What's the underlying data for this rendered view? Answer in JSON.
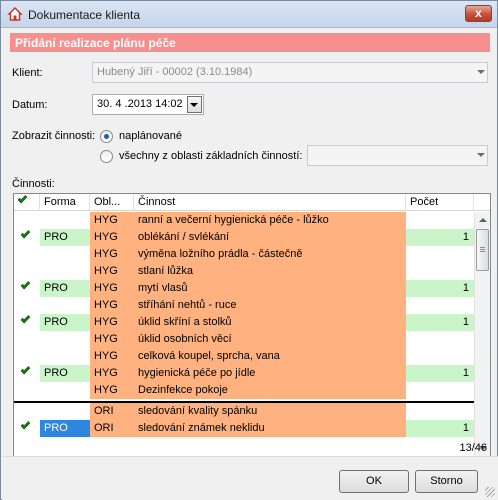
{
  "window": {
    "title": "Dokumentace klienta",
    "close_label": "x"
  },
  "banner": {
    "text": "Přidání realizace plánu péče"
  },
  "client": {
    "label": "Klient:",
    "value": "Hubený Jiří - 00002 (3.10.1984)"
  },
  "date": {
    "label": "Datum:",
    "value": "30. 4 .2013 14:02"
  },
  "show": {
    "label": "Zobrazit činnosti:",
    "options": [
      {
        "label": "naplánované",
        "selected": true
      },
      {
        "label": "všechny z oblasti základních činností:",
        "selected": false
      }
    ],
    "area_value": ""
  },
  "activities": {
    "label": "Činnosti:",
    "columns": [
      "",
      "Forma",
      "Obl...",
      "Činnost",
      "Počet"
    ],
    "rows": [
      {
        "checked": false,
        "forma": "",
        "obl": "HYG",
        "cinnost": "ranní a večerní hygienická péče - lůžko",
        "pocet": ""
      },
      {
        "checked": true,
        "forma": "PRO",
        "obl": "HYG",
        "cinnost": "oblékání / svlékání",
        "pocet": "1"
      },
      {
        "checked": false,
        "forma": "",
        "obl": "HYG",
        "cinnost": "výměna ložního prádla - částečně",
        "pocet": ""
      },
      {
        "checked": false,
        "forma": "",
        "obl": "HYG",
        "cinnost": "stlaní lůžka",
        "pocet": ""
      },
      {
        "checked": true,
        "forma": "PRO",
        "obl": "HYG",
        "cinnost": "mytí vlasů",
        "pocet": "1"
      },
      {
        "checked": false,
        "forma": "",
        "obl": "HYG",
        "cinnost": "stříhání nehtů - ruce",
        "pocet": ""
      },
      {
        "checked": true,
        "forma": "PRO",
        "obl": "HYG",
        "cinnost": "úklid skříní a stolků",
        "pocet": "1"
      },
      {
        "checked": false,
        "forma": "",
        "obl": "HYG",
        "cinnost": "úklid osobních věcí",
        "pocet": ""
      },
      {
        "checked": false,
        "forma": "",
        "obl": "HYG",
        "cinnost": "celková koupel, sprcha, vana",
        "pocet": ""
      },
      {
        "checked": true,
        "forma": "PRO",
        "obl": "HYG",
        "cinnost": "hygienická péče po jídle",
        "pocet": "1"
      },
      {
        "checked": false,
        "forma": "",
        "obl": "HYG",
        "cinnost": "Dezinfekce pokoje",
        "pocet": ""
      },
      {
        "checked": false,
        "forma": "",
        "obl": "ORI",
        "cinnost": "sledování kvality spánku",
        "pocet": ""
      },
      {
        "checked": true,
        "forma": "PRO",
        "obl": "ORI",
        "cinnost": "sledování známek neklidu",
        "pocet": "1"
      }
    ],
    "counter": "13/46"
  },
  "buttons": {
    "ok": "OK",
    "cancel": "Storno"
  },
  "colors": {
    "banner": "#f88f8f",
    "activity_fill": "#ffb27f",
    "pro_fill": "#c9f5c9",
    "selection": "#2e86de",
    "check": "#1d6e1d"
  }
}
